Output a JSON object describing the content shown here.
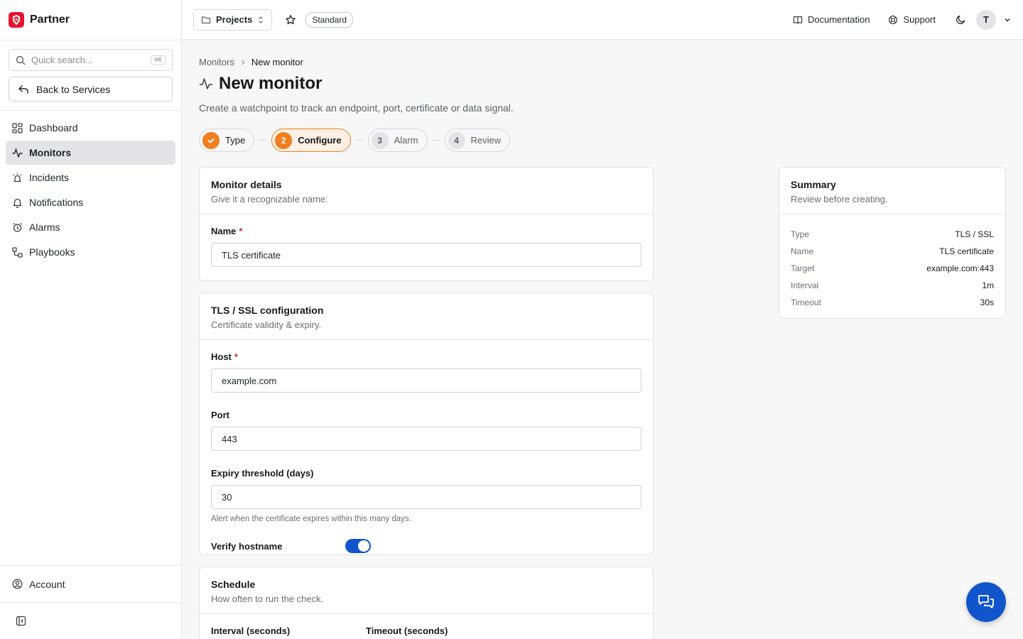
{
  "brand": {
    "name": "Partner"
  },
  "sidebar": {
    "search_placeholder": "Quick search...",
    "search_shortcut": "⌘K",
    "back_label": "Back to Services",
    "items": [
      {
        "label": "Dashboard",
        "icon": "dashboard-icon",
        "active": false
      },
      {
        "label": "Monitors",
        "icon": "pulse-icon",
        "active": true
      },
      {
        "label": "Incidents",
        "icon": "siren-icon",
        "active": false
      },
      {
        "label": "Notifications",
        "icon": "bell-icon",
        "active": false
      },
      {
        "label": "Alarms",
        "icon": "alarm-clock-icon",
        "active": false
      },
      {
        "label": "Playbooks",
        "icon": "workflow-icon",
        "active": false
      }
    ],
    "account_label": "Account"
  },
  "topbar": {
    "projects_label": "Projects",
    "plan_badge": "Standard",
    "docs_label": "Documentation",
    "support_label": "Support",
    "avatar_initial": "T"
  },
  "breadcrumb": {
    "parent": "Monitors",
    "current": "New monitor"
  },
  "page": {
    "title": "New monitor",
    "subtitle": "Create a watchpoint to track an endpoint, port, certificate or data signal."
  },
  "steps": [
    {
      "num": "1",
      "label": "Type",
      "state": "done"
    },
    {
      "num": "2",
      "label": "Configure",
      "state": "active"
    },
    {
      "num": "3",
      "label": "Alarm",
      "state": "pending"
    },
    {
      "num": "4",
      "label": "Review",
      "state": "pending"
    }
  ],
  "details_card": {
    "title": "Monitor details",
    "desc": "Give it a recognizable name.",
    "name_label": "Name",
    "name_value": "TLS certificate"
  },
  "tls_card": {
    "title": "TLS / SSL configuration",
    "desc": "Certificate validity & expiry.",
    "host_label": "Host",
    "host_value": "example.com",
    "port_label": "Port",
    "port_value": "443",
    "expiry_label": "Expiry threshold (days)",
    "expiry_value": "30",
    "expiry_help": "Alert when the certificate expires within this many days.",
    "verify_label": "Verify hostname",
    "verify_on": true
  },
  "schedule_card": {
    "title": "Schedule",
    "desc": "How often to run the check.",
    "interval_label": "Interval (seconds)",
    "timeout_label": "Timeout (seconds)"
  },
  "summary": {
    "title": "Summary",
    "desc": "Review before creating.",
    "rows": [
      {
        "key": "Type",
        "value": "TLS / SSL"
      },
      {
        "key": "Name",
        "value": "TLS certificate"
      },
      {
        "key": "Target",
        "value": "example.com:443"
      },
      {
        "key": "Interval",
        "value": "1m"
      },
      {
        "key": "Timeout",
        "value": "30s"
      }
    ]
  },
  "colors": {
    "accent": "#f07f1f",
    "primary": "#1155cc",
    "brand": "#e5132d"
  }
}
